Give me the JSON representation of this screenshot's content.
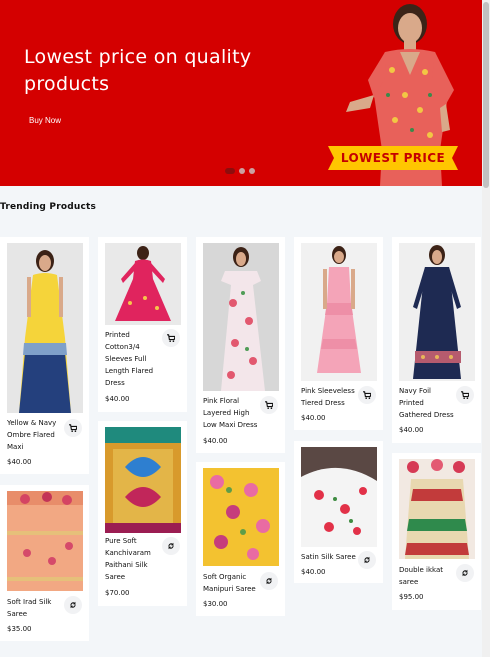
{
  "hero": {
    "title": "Lowest price on quality products",
    "cta": "Buy Now",
    "badge": "LOWEST PRICE",
    "colors": {
      "background": "#d40000",
      "badge": "#ffc600"
    },
    "slides": 3,
    "active_slide": 1
  },
  "section": {
    "title": "Trending Products"
  },
  "products": [
    {
      "name": "Yellow & Navy Ombre Flared Maxi",
      "price": "$40.00",
      "action_icon": "cart-icon"
    },
    {
      "name": "Printed Cotton3/4 Sleeves Full Length Flared Dress",
      "price": "$40.00",
      "action_icon": "cart-icon"
    },
    {
      "name": "Pink Floral Layered High Low Maxi Dress",
      "price": "$40.00",
      "action_icon": "cart-icon"
    },
    {
      "name": "Pink Sleeveless Tiered Dress",
      "price": "$40.00",
      "action_icon": "cart-icon"
    },
    {
      "name": "Navy Foil Printed Gathered Dress",
      "price": "$40.00",
      "action_icon": "cart-icon"
    },
    {
      "name": "Soft Irad Silk Saree",
      "price": "$35.00",
      "action_icon": "options-icon"
    },
    {
      "name": "Pure Soft Kanchivaram Paithani Silk Saree",
      "price": "$70.00",
      "action_icon": "options-icon"
    },
    {
      "name": "Soft Organic Manipuri Saree",
      "price": "$30.00",
      "action_icon": "options-icon"
    },
    {
      "name": "Satin Silk Saree",
      "price": "$40.00",
      "action_icon": "options-icon"
    },
    {
      "name": "Double ikkat saree",
      "price": "$95.00",
      "action_icon": "options-icon"
    }
  ]
}
